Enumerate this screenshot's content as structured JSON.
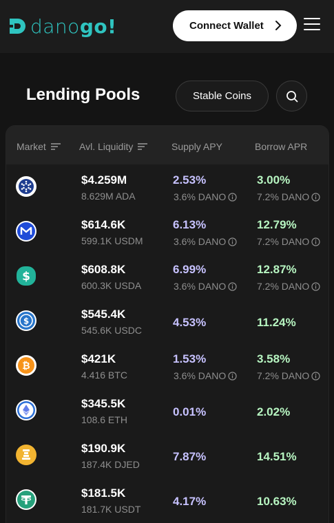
{
  "brand": {
    "part1": "dano",
    "part2": "go!"
  },
  "header": {
    "connect_label": "Connect Wallet"
  },
  "page": {
    "title": "Lending Pools",
    "filter_label": "Stable Coins"
  },
  "colors": {
    "supply": "#c7c2ff",
    "borrow": "#b7f5c1",
    "accent": "#2fc4c0"
  },
  "table": {
    "columns": [
      "Market",
      "Avl. Liquidity",
      "Supply APY",
      "Borrow APR"
    ],
    "rows": [
      {
        "icon": "ada-icon",
        "liquidity": "$4.259M",
        "liquidity_sub": "8.629M ADA",
        "supply": "2.53%",
        "supply_reward": "3.6% DANO",
        "borrow": "3.00%",
        "borrow_reward": "7.2% DANO"
      },
      {
        "icon": "usdm-icon",
        "liquidity": "$614.6K",
        "liquidity_sub": "599.1K USDM",
        "supply": "6.13%",
        "supply_reward": "3.6% DANO",
        "borrow": "12.79%",
        "borrow_reward": "7.2% DANO"
      },
      {
        "icon": "usda-icon",
        "liquidity": "$608.8K",
        "liquidity_sub": "600.3K USDA",
        "supply": "6.99%",
        "supply_reward": "3.6% DANO",
        "borrow": "12.87%",
        "borrow_reward": "7.2% DANO"
      },
      {
        "icon": "usdc-icon",
        "liquidity": "$545.4K",
        "liquidity_sub": "545.6K USDC",
        "supply": "4.53%",
        "supply_reward": "",
        "borrow": "11.24%",
        "borrow_reward": ""
      },
      {
        "icon": "btc-icon",
        "liquidity": "$421K",
        "liquidity_sub": "4.416 BTC",
        "supply": "1.53%",
        "supply_reward": "3.6% DANO",
        "borrow": "3.58%",
        "borrow_reward": "7.2% DANO"
      },
      {
        "icon": "eth-icon",
        "liquidity": "$345.5K",
        "liquidity_sub": "108.6 ETH",
        "supply": "0.01%",
        "supply_reward": "",
        "borrow": "2.02%",
        "borrow_reward": ""
      },
      {
        "icon": "djed-icon",
        "liquidity": "$190.9K",
        "liquidity_sub": "187.4K DJED",
        "supply": "7.87%",
        "supply_reward": "",
        "borrow": "14.51%",
        "borrow_reward": ""
      },
      {
        "icon": "usdt-icon",
        "liquidity": "$181.5K",
        "liquidity_sub": "181.7K USDT",
        "supply": "4.17%",
        "supply_reward": "",
        "borrow": "10.63%",
        "borrow_reward": ""
      }
    ]
  }
}
